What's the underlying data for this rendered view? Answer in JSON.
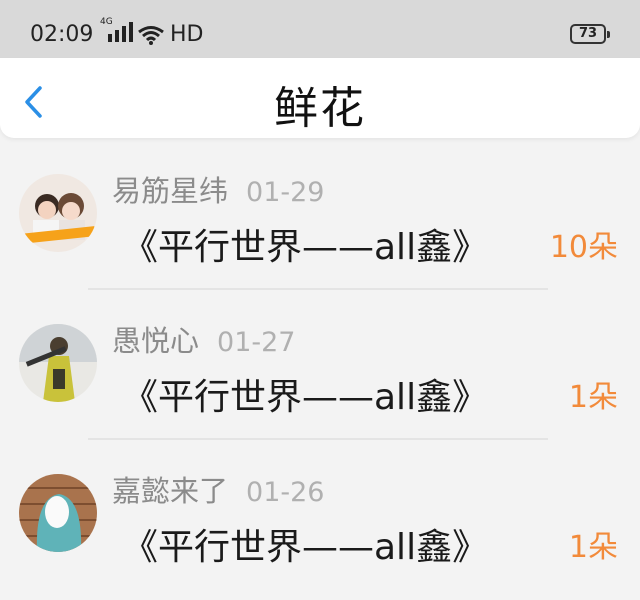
{
  "status_bar": {
    "time": "02:09",
    "network": "4G",
    "hd": "HD",
    "battery": "73",
    "icons": [
      "signal-icon",
      "wifi-icon",
      "battery-icon"
    ]
  },
  "header": {
    "title": "鲜花",
    "back_icon": "chevron-left-icon"
  },
  "colors": {
    "accent_blue": "#2b8fe6",
    "count_orange": "#f28a3a",
    "username_gray": "#8b8b8b",
    "date_gray": "#b0b0b0"
  },
  "items": [
    {
      "username": "易筋星纬",
      "date": "01-29",
      "title": "《平行世界——all鑫》",
      "count": "10朵"
    },
    {
      "username": "愚悦心",
      "date": "01-27",
      "title": "《平行世界——all鑫》",
      "count": "1朵"
    },
    {
      "username": "嘉懿来了",
      "date": "01-26",
      "title": "《平行世界——all鑫》",
      "count": "1朵"
    }
  ]
}
